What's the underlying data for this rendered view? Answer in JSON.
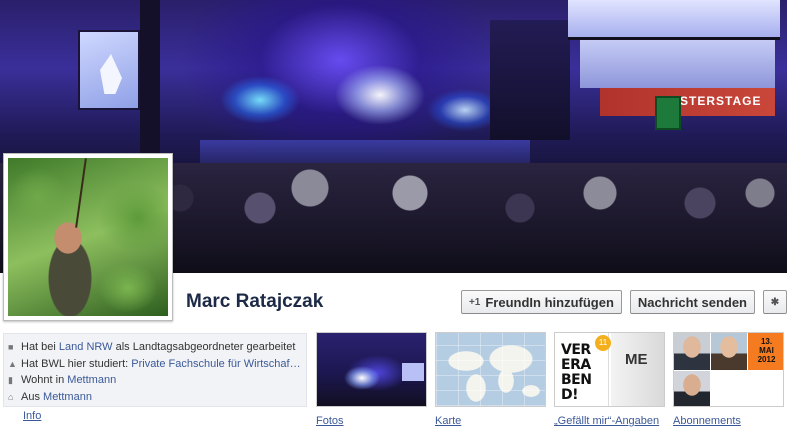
{
  "profile": {
    "name": "Marc Ratajczak"
  },
  "actions": {
    "add_friend_label": "FreundIn hinzufügen",
    "add_friend_icon": "+1",
    "message_label": "Nachricht senden",
    "settings_icon": "gear-icon"
  },
  "cover": {
    "banner_text": "STERSTAGE"
  },
  "info": {
    "label": "Info",
    "lines": [
      {
        "icon": "briefcase-icon",
        "pre": "Hat bei ",
        "link": "Land NRW",
        "post": " als Landtagsabgeordneter gearbeitet"
      },
      {
        "icon": "graduation-cap-icon",
        "pre": "Hat BWL hier studiert: ",
        "link": "Private Fachschule für Wirtschaf…",
        "post": ""
      },
      {
        "icon": "home-icon",
        "pre": "Wohnt in ",
        "link": "Mettmann",
        "post": ""
      },
      {
        "icon": "house-icon",
        "pre": "Aus ",
        "link": "Mettmann",
        "post": ""
      }
    ]
  },
  "thumbnails": {
    "fotos": "Fotos",
    "karte": "Karte",
    "likes": "„Gefällt mir“-Angaben",
    "likes_badge": "11",
    "likes_poster": "VER\nERA\nBEN\nD!",
    "likes_side": "ME",
    "abos": "Abonnements",
    "abos_poster": "13.\nMAI\n2012"
  }
}
